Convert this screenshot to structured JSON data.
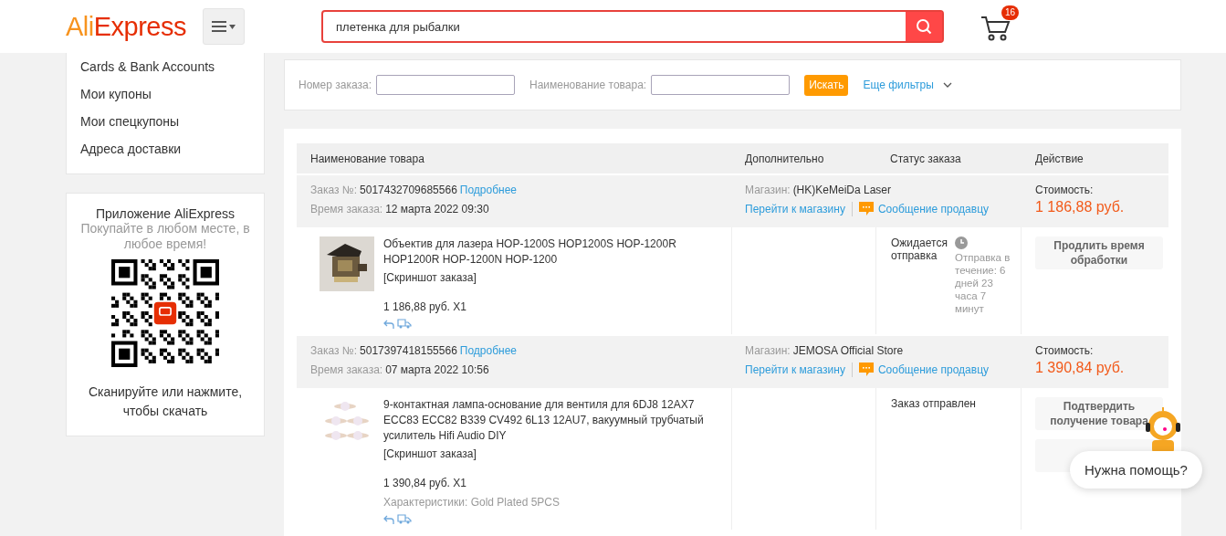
{
  "header": {
    "logo": "AliExpress",
    "search": {
      "value": "плетенка для рыбалки"
    },
    "cart_count": "16"
  },
  "sidebar": {
    "items": [
      "Cards & Bank Accounts",
      "Мои купоны",
      "Мои спецкупоны",
      "Адреса доставки"
    ]
  },
  "app_promo": {
    "title": "Приложение AliExpress",
    "subtitle": "Покупайте в любом месте, в любое время!",
    "caption": "Сканируйте или нажмите, чтобы скачать"
  },
  "filters": {
    "fields": [
      {
        "label": "Номер заказа:"
      },
      {
        "label": "Наименование товара:"
      }
    ],
    "search_button": "Искать",
    "more_filters": "Еще фильтры"
  },
  "table": {
    "columns": [
      "Наименование товара",
      "Дополнительно",
      "Статус заказа",
      "Действие"
    ],
    "orders": [
      {
        "order_label": "Заказ №:",
        "order_number": "5017432709685566",
        "details_link": "Подробнее",
        "time_label": "Время заказа:",
        "time": "12 марта 2022 09:30",
        "store_label": "Магазин:",
        "store": "(HK)KeMeiDa Laser",
        "store_link": "Перейти к магазину",
        "message_link": "Сообщение продавцу",
        "cost_label": "Стоимость:",
        "cost": "1 186,88 руб.",
        "product": {
          "title": "Объектив для лазера HOP-1200S HOP1200S HOP-1200R HOP1200R HOP-1200N HOP-1200",
          "screenshot_link": "[Скриншот заказа]",
          "price": "1 186,88 руб. X1"
        },
        "status": "Ожидается отправка",
        "status_note": "Отправка в течение: 6 дней 23 часа 7 минут",
        "actions": [
          {
            "kind": "labeled",
            "label": "Продлить время обработки"
          }
        ]
      },
      {
        "order_label": "Заказ №:",
        "order_number": "5017397418155566",
        "details_link": "Подробнее",
        "time_label": "Время заказа:",
        "time": "07 марта 2022 10:56",
        "store_label": "Магазин:",
        "store": "JEMOSA Official Store",
        "store_link": "Перейти к магазину",
        "message_link": "Сообщение продавцу",
        "cost_label": "Стоимость:",
        "cost": "1 390,84 руб.",
        "product": {
          "title": "9-контактная лампа-основание для вентиля для 6DJ8 12AX7 ECC83 ECC82 B339 CV492 6L13 12AU7, вакуумный трубчатый усилитель Hifi Audio DIY",
          "screenshot_link": "[Скриншот заказа]",
          "price": "1 390,84 руб. X1",
          "specs": "Характеристики: Gold Plated 5PCS"
        },
        "status": "Заказ отправлен",
        "actions": [
          {
            "kind": "labeled",
            "label": "Подтвердить получение товара"
          },
          {
            "kind": "covered"
          }
        ]
      }
    ]
  },
  "help": {
    "label": "Нужна помощь?"
  }
}
